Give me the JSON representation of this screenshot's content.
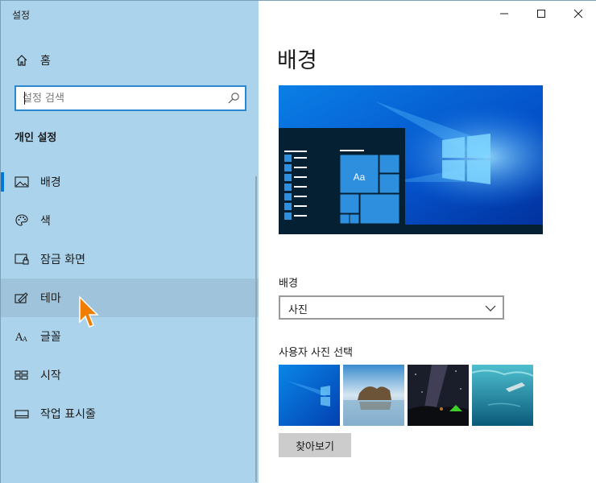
{
  "window": {
    "title": "설정",
    "controls": {
      "minimize": "minimize-icon",
      "maximize": "maximize-icon",
      "close": "close-icon"
    }
  },
  "sidebar": {
    "home_label": "홈",
    "search": {
      "placeholder": "설정 검색",
      "value": ""
    },
    "section_heading": "개인 설정",
    "items": [
      {
        "label": "배경",
        "icon": "picture-icon",
        "selected": true
      },
      {
        "label": "색",
        "icon": "palette-icon"
      },
      {
        "label": "잠금 화면",
        "icon": "lock-screen-icon"
      },
      {
        "label": "테마",
        "icon": "theme-brush-icon",
        "hover": true
      },
      {
        "label": "글꼴",
        "icon": "font-icon"
      },
      {
        "label": "시작",
        "icon": "start-icon"
      },
      {
        "label": "작업 표시줄",
        "icon": "taskbar-icon"
      }
    ]
  },
  "main": {
    "title": "배경",
    "preview": {
      "tile_text": "Aa"
    },
    "background_label": "배경",
    "background_value": "사진",
    "choose_photo_label": "사용자 사진 선택",
    "browse_label": "찾아보기"
  },
  "colors": {
    "accent": "#0078d7",
    "sidebar": "#acd3ec",
    "cursor": "#f07c00"
  }
}
